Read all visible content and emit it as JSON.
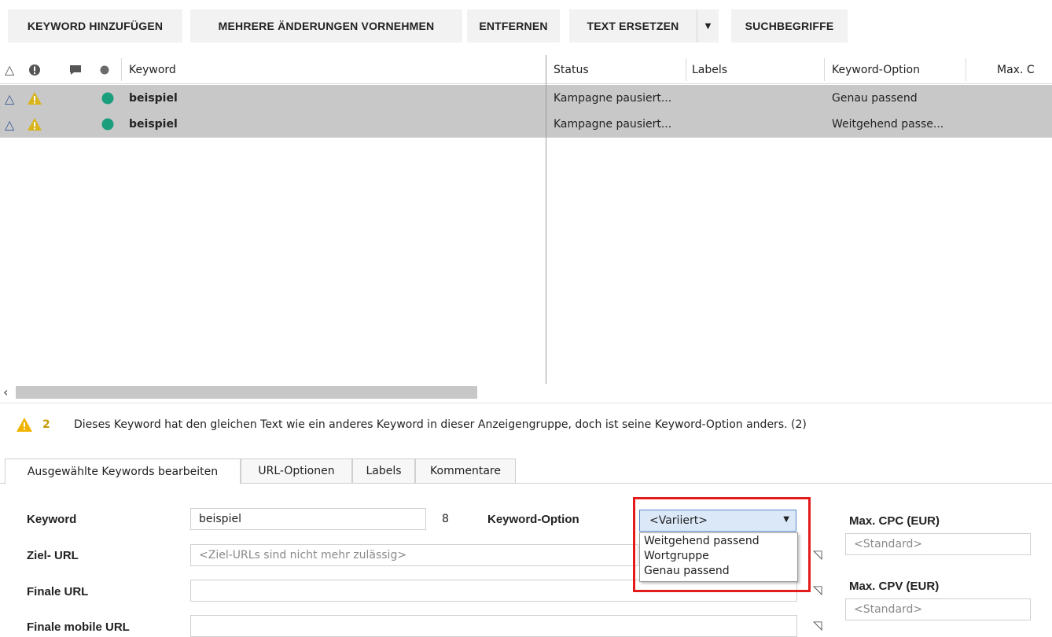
{
  "toolbar": {
    "add_keyword": "KEYWORD HINZUFÜGEN",
    "multiple_changes": "MEHRERE ÄNDERUNGEN VORNEHMEN",
    "remove": "ENTFERNEN",
    "replace_text": "TEXT ERSETZEN",
    "search_terms": "SUCHBEGRIFFE"
  },
  "grid": {
    "columns": {
      "keyword": "Keyword",
      "status": "Status",
      "labels": "Labels",
      "keyword_option": "Keyword-Option",
      "max": "Max. C"
    },
    "rows": [
      {
        "keyword": "beispiel",
        "status": "Kampagne pausiert...",
        "labels": "",
        "keyword_option": "Genau passend"
      },
      {
        "keyword": "beispiel",
        "status": "Kampagne pausiert...",
        "labels": "",
        "keyword_option": "Weitgehend passe..."
      }
    ]
  },
  "warning": {
    "count": "2",
    "message": "Dieses Keyword hat den gleichen Text wie ein anderes Keyword in dieser Anzeigengruppe, doch ist seine Keyword-Option anders. (2)"
  },
  "tabs": [
    {
      "label": "Ausgewählte Keywords bearbeiten"
    },
    {
      "label": "URL-Optionen"
    },
    {
      "label": "Labels"
    },
    {
      "label": "Kommentare"
    }
  ],
  "form": {
    "keyword_label": "Keyword",
    "keyword_value": "beispiel",
    "keyword_length": "8",
    "keyword_option_label": "Keyword-Option",
    "keyword_option_value": "<Variiert>",
    "keyword_option_options": [
      "Weitgehend passend",
      "Wortgruppe",
      "Genau passend"
    ],
    "ziel_url_label": "Ziel- URL",
    "ziel_url_placeholder": "<Ziel-URLs sind nicht mehr zulässig>",
    "finale_url_label": "Finale URL",
    "finale_mobile_url_label": "Finale mobile URL",
    "max_cpc_label": "Max. CPC (EUR)",
    "max_cpc_placeholder": "<Standard>",
    "max_cpv_label": "Max. CPV (EUR)",
    "max_cpv_placeholder": "<Standard>"
  },
  "colors": {
    "status_dot": "#1a9e7c",
    "warning_triangle": "#e0b000",
    "highlight": "#e41b1b"
  }
}
